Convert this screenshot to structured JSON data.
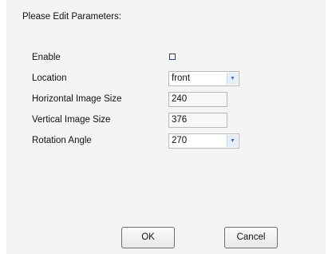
{
  "dialog": {
    "heading": "Please Edit Parameters:"
  },
  "params": {
    "enable": {
      "label": "Enable",
      "checked": false
    },
    "location": {
      "label": "Location",
      "value": "front"
    },
    "horizontal_size": {
      "label": "Horizontal Image Size",
      "value": "240"
    },
    "vertical_size": {
      "label": "Vertical Image Size",
      "value": "376"
    },
    "rotation": {
      "label": "Rotation Angle",
      "value": "270"
    }
  },
  "buttons": {
    "ok": "OK",
    "cancel": "Cancel"
  },
  "icons": {
    "dropdown": "chevron-down-icon"
  },
  "colors": {
    "background": "#f4f4f4",
    "arrow": "#4c6fb3",
    "checkbox_border": "#2a3f7a"
  }
}
